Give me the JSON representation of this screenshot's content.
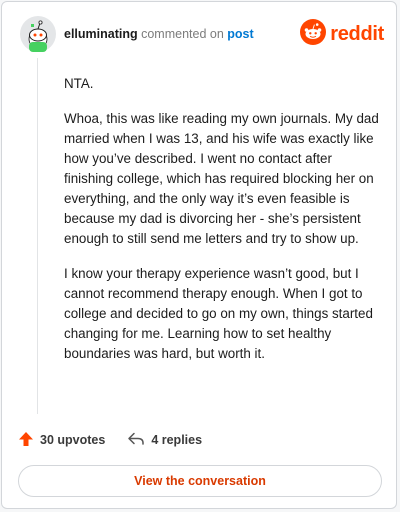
{
  "header": {
    "username": "elluminating",
    "verb": "commented on",
    "post_link": "post",
    "logo_text": "reddit"
  },
  "comment": {
    "paragraphs": [
      "NTA.",
      "Whoa, this was like reading my own journals. My dad married when I was 13, and his wife was exactly like how you’ve described. I went no contact after finishing college, which has required blocking her on everything, and the only way it’s even feasible is because my dad is divorcing her - she’s persistent enough to still send me letters and try to show up.",
      "I know your therapy experience wasn’t good, but I cannot recommend therapy enough. When I got to college and decided to go on my own, things started changing for me. Learning how to set healthy boundaries was hard, but worth it."
    ]
  },
  "actions": {
    "upvotes": "30 upvotes",
    "replies": "4 replies"
  },
  "cta": {
    "label": "View the conversation"
  },
  "colors": {
    "accent": "#ff4500",
    "link": "#0079d3",
    "cta_text": "#d93a00"
  },
  "icons": {
    "avatar": "snoo-avatar-icon",
    "logo": "reddit-snoo-icon",
    "upvote": "upvote-arrow-icon",
    "reply": "reply-arrow-icon"
  }
}
